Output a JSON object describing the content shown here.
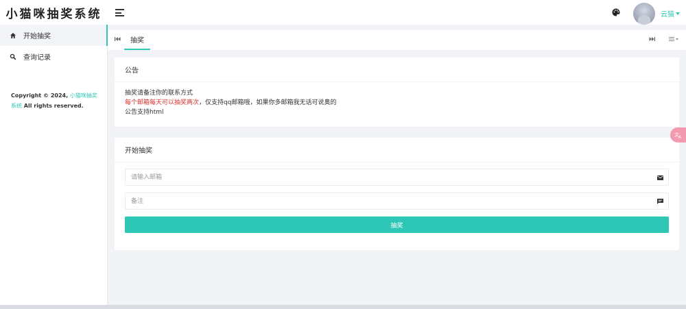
{
  "app": {
    "logo_text": "小猫咪抽奖系统"
  },
  "header": {
    "user_name": "云猫",
    "accent_color": "#2ec7b6"
  },
  "sidebar": {
    "items": [
      {
        "label": "开始抽奖",
        "icon": "home-icon",
        "active": true
      },
      {
        "label": "查询记录",
        "icon": "search-icon",
        "active": false
      }
    ],
    "copyright_prefix": "Copyright © 2024, ",
    "copyright_link": "小猫咪抽奖系统",
    "copyright_suffix": " All rights reserved."
  },
  "tabs": {
    "items": [
      {
        "label": "抽奖",
        "active": true
      }
    ],
    "prev_icon": "skip-back-icon",
    "next_icon": "skip-forward-icon",
    "menu_icon": "list-menu-icon"
  },
  "notice": {
    "title": "公告",
    "line1": "抽奖请备注你的联系方式",
    "line2_red": "每个邮箱每天可以抽奖两次",
    "line2_rest": "，仅支持qq邮箱哦，如果你多邮箱我无话可说奥的",
    "line3": "公告支持html"
  },
  "draw_form": {
    "title": "开始抽奖",
    "email_placeholder": "请输入邮箱",
    "email_value": "",
    "remark_placeholder": "备注",
    "remark_value": "",
    "submit_label": "抽奖",
    "button_color": "#2ec7b6"
  },
  "floating": {
    "translate_icon": "translate-icon"
  }
}
